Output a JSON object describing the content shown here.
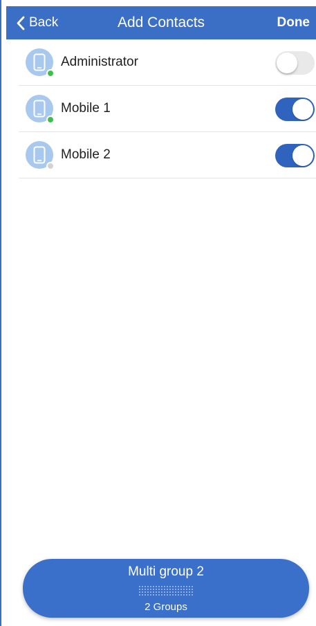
{
  "nav": {
    "back_label": "Back",
    "title": "Add Contacts",
    "done_label": "Done"
  },
  "contacts": [
    {
      "name": "Administrator",
      "status": "online",
      "selected": false
    },
    {
      "name": "Mobile 1",
      "status": "online",
      "selected": true
    },
    {
      "name": "Mobile 2",
      "status": "offline",
      "selected": true
    }
  ],
  "group_selector": {
    "name": "Multi group 2",
    "count_label": "2 Groups"
  },
  "icons": {
    "back": "chevron-left-icon",
    "contact": "mobile-device-icon",
    "status": "presence-dot"
  },
  "colors": {
    "accent": "#3b6fc6",
    "toggle_on": "#2f63bd",
    "toggle_off": "#e9e9ea",
    "avatar": "#a9c8ee",
    "status_online": "#3fbf4a",
    "status_offline": "#d3d3d6"
  }
}
